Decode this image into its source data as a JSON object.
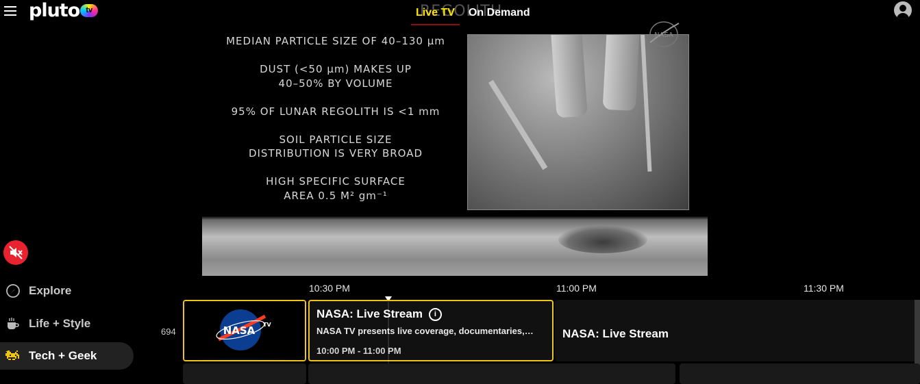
{
  "header": {
    "logo_text": "pluto",
    "logo_badge": "tv",
    "nav": [
      {
        "label": "Live TV",
        "active": true
      },
      {
        "label": "On Demand",
        "active": false
      }
    ]
  },
  "video": {
    "slide_title": "REGOLITH",
    "facts": [
      "MEDIAN PARTICLE SIZE OF 40–130 µm",
      "DUST (<50 µm) MAKES UP\n40–50% BY VOLUME",
      "95% OF LUNAR REGOLITH IS <1 mm",
      "SOIL PARTICLE SIZE\nDISTRIBUTION IS VERY BROAD",
      "HIGH SPECIFIC SURFACE\nAREA 0.5 M² gm⁻¹"
    ]
  },
  "sidebar": {
    "categories": [
      {
        "label": "Explore",
        "icon": "compass-icon",
        "active": false
      },
      {
        "label": "Life + Style",
        "icon": "coffee-cup-icon",
        "active": false
      },
      {
        "label": "Tech + Geek",
        "icon": "space-invader-icon",
        "active": true
      }
    ]
  },
  "guide": {
    "times": [
      "10:30 PM",
      "11:00 PM",
      "11:30 PM"
    ],
    "channel": {
      "number": "694",
      "logo_text": "NASA",
      "logo_badge": "TV"
    },
    "current_program": {
      "title": "NASA: Live Stream",
      "description": "NASA TV presents live coverage, documentaries, and more",
      "time": "10:00 PM - 11:00 PM"
    },
    "next_program": {
      "title": "NASA: Live Stream"
    }
  },
  "colors": {
    "accent": "#ffe400",
    "focus_border": "#f0c419",
    "mute_button": "#e8232f"
  }
}
